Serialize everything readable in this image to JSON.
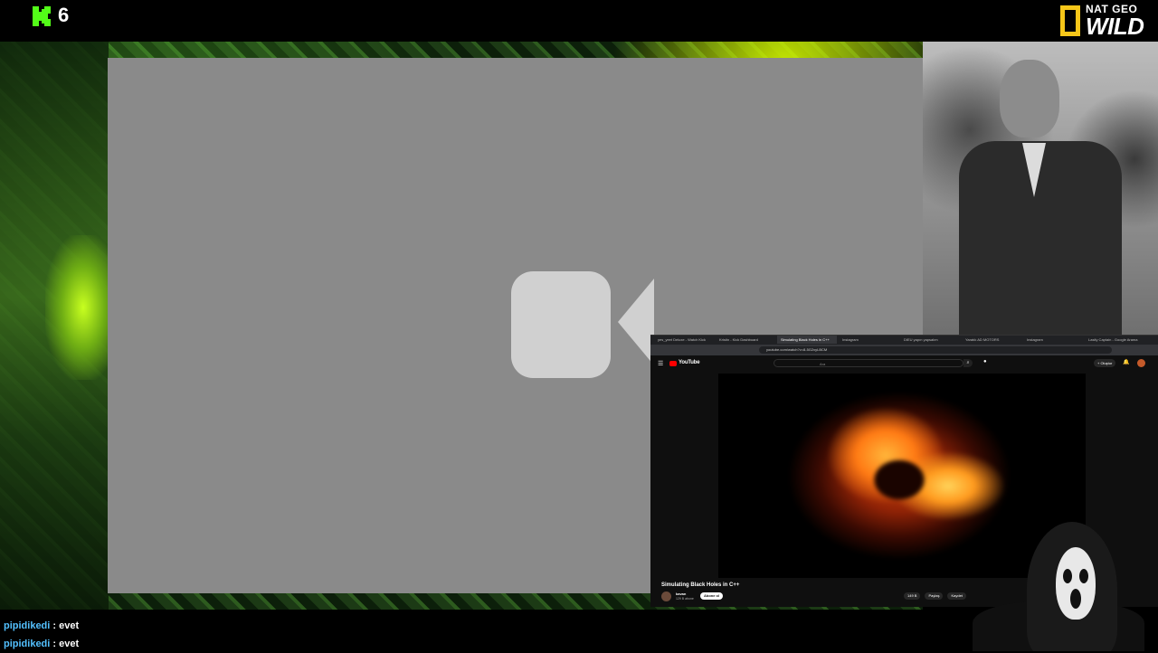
{
  "topbar": {
    "viewer_count": "6",
    "kick_logo_icon": "kick-k-logo-icon",
    "natgeo_line1": "NAT GEO",
    "natgeo_line2": "WILD"
  },
  "camera_placeholder": {
    "icon": "video-camera-icon"
  },
  "youtube": {
    "tabs": [
      "yes_yeet Deluxe - Watch Kick",
      "Kristin - Kick Dashboard",
      "Simulating Black Holes in C++",
      "Instagram",
      "DIEU yapın yapsalım",
      "Yaratık AD MOTORS",
      "Instagram",
      "Lastly Captain - Google Arama"
    ],
    "url": "youtube.com/watch?v=8-5G2xyLBCM",
    "logo": "YouTube",
    "search_placeholder": "Ara",
    "create_label": "+ Oluştur",
    "video_title": "Simulating Black Holes in C++",
    "channel_name": "kavan",
    "channel_subs": "129 B abone",
    "subscribe_label": "Abone ol",
    "likes": "149 B",
    "share_label": "Paylaş",
    "save_label": "Kaydet"
  },
  "chat": [
    {
      "user": "pipidikedi",
      "text": "evet"
    },
    {
      "user": "pipidikedi",
      "text": "evet"
    }
  ],
  "colors": {
    "kick_green": "#53fc18",
    "natgeo_yellow": "#f6c619",
    "chat_username": "#53c0ff",
    "placeholder_gray": "#8a8a8a",
    "youtube_red": "#ff0000"
  }
}
